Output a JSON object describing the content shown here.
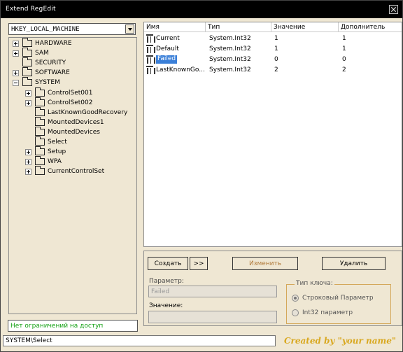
{
  "window": {
    "title": "Extend  RegEdit",
    "close_icon": "close-icon"
  },
  "hive_combo": {
    "selected": "HKEY_LOCAL_MACHINE"
  },
  "tree": [
    {
      "label": "HARDWARE",
      "expander": "plus",
      "level": 0
    },
    {
      "label": "SAM",
      "expander": "plus",
      "level": 0
    },
    {
      "label": "SECURITY",
      "expander": "none",
      "level": 0
    },
    {
      "label": "SOFTWARE",
      "expander": "plus",
      "level": 0
    },
    {
      "label": "SYSTEM",
      "expander": "minus",
      "level": 0
    },
    {
      "label": "ControlSet001",
      "expander": "plus",
      "level": 1
    },
    {
      "label": "ControlSet002",
      "expander": "plus",
      "level": 1
    },
    {
      "label": "LastKnownGoodRecovery",
      "expander": "none",
      "level": 1
    },
    {
      "label": "MountedDevices1",
      "expander": "none",
      "level": 1
    },
    {
      "label": "MountedDevices",
      "expander": "none",
      "level": 1
    },
    {
      "label": "Select",
      "expander": "none",
      "level": 1,
      "selected": true
    },
    {
      "label": "Setup",
      "expander": "plus",
      "level": 1
    },
    {
      "label": "WPA",
      "expander": "plus",
      "level": 1
    },
    {
      "label": "CurrentControlSet",
      "expander": "plus",
      "level": 1
    }
  ],
  "access_status": "Нет ограничений на доступ",
  "list": {
    "columns": [
      "Имя",
      "Тип",
      "Значение",
      "Дополнитель"
    ],
    "rows": [
      {
        "name": "Current",
        "type": "System.Int32",
        "value": "1",
        "extra": "1",
        "selected": false
      },
      {
        "name": "Default",
        "type": "System.Int32",
        "value": "1",
        "extra": "1",
        "selected": false
      },
      {
        "name": "Failed",
        "type": "System.Int32",
        "value": "0",
        "extra": "0",
        "selected": true
      },
      {
        "name": "LastKnownGo...",
        "type": "System.Int32",
        "value": "2",
        "extra": "2",
        "selected": false
      }
    ]
  },
  "editor": {
    "create_label": "Создать",
    "more_label": ">>",
    "modify_label": "Изменить",
    "delete_label": "Удалить",
    "param_label": "Параметр:",
    "param_value": "Failed",
    "value_label": "Значение:",
    "value_value": "",
    "key_type_title": "Тип ключа:",
    "radio_string_label": "Строковый Параметр",
    "radio_int32_label": "Int32 параметр"
  },
  "statusbar": {
    "path": "SYSTEM\\Select"
  },
  "credit": "Created by \"your name\"",
  "colors": {
    "window_bg": "#efe7d3",
    "selection": "#3a7fd8",
    "access_text": "#12a012",
    "credit_text": "#d9a820"
  }
}
